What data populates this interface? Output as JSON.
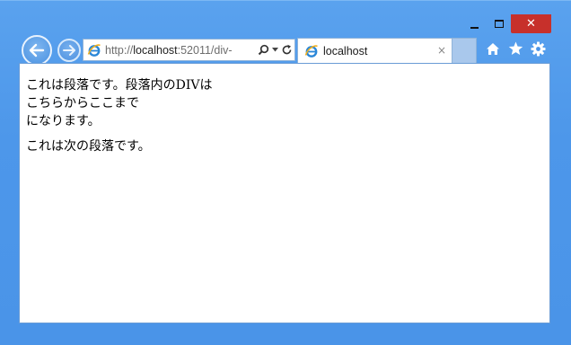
{
  "window": {
    "controls": {
      "minimize": "minimize-icon",
      "maximize": "maximize-icon",
      "close": "close-icon"
    }
  },
  "toolbar": {
    "back": "back-arrow-icon",
    "forward": "forward-arrow-icon",
    "address": {
      "scheme": "http://",
      "host": "localhost",
      "rest": ":52011/div-"
    },
    "search_icon": "search-icon",
    "dropdown_icon": "dropdown-icon",
    "refresh_icon": "refresh-icon",
    "icons": [
      "home-icon",
      "favorites-star-icon",
      "settings-gear-icon"
    ]
  },
  "tab": {
    "title": "localhost",
    "close_glyph": "×"
  },
  "content": {
    "paragraph1_before": "これは段落です。段落内のDIVは",
    "div_line1": "こちらからここまで",
    "div_line2": "になります。",
    "paragraph2": "これは次の段落です。"
  },
  "colors": {
    "frame": "#4a94e8",
    "close_button": "#c7302b",
    "tab_area": "#a9c8ec"
  }
}
